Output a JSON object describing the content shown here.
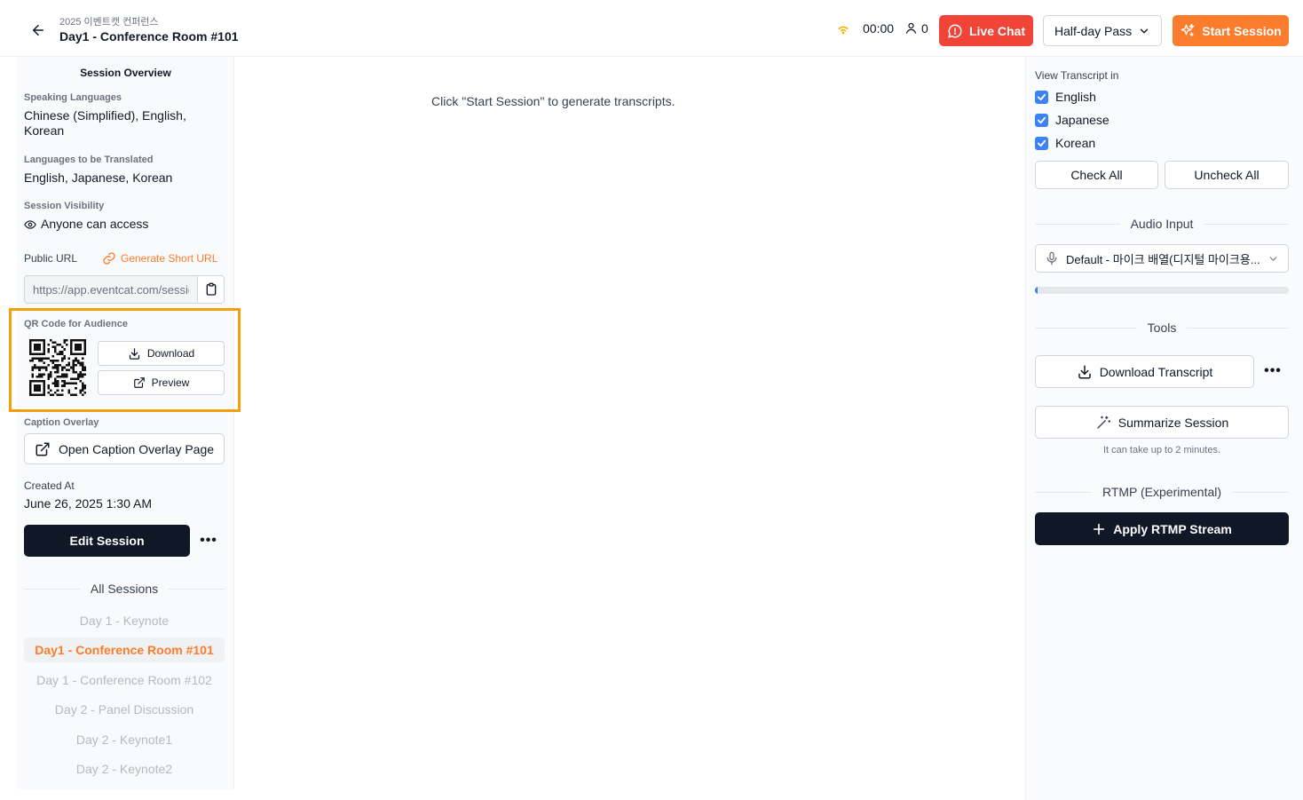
{
  "header": {
    "event_name": "2025 이벤트캣 컨퍼런스",
    "session_title": "Day1 - Conference Room #101",
    "timer": "00:00",
    "audience_count": "0",
    "live_chat_label": "Live Chat",
    "pass_select_value": "Half-day Pass",
    "start_session_label": "Start Session",
    "icons": {
      "back": "arrow-left-icon",
      "signal": "wifi-icon",
      "audience": "user-icon",
      "chat": "chat-bubble-icon",
      "chevron": "chevron-down-icon",
      "sparkle": "sparkle-icon"
    },
    "colors": {
      "live_chat": "#f04438",
      "start_session": "#fb7c2c",
      "signal": "#f5b301"
    }
  },
  "sidebar": {
    "title": "Session Overview",
    "speaking_languages_label": "Speaking Languages",
    "speaking_languages_value": "Chinese (Simplified), English, Korean",
    "translated_languages_label": "Languages to be Translated",
    "translated_languages_value": "English, Japanese, Korean",
    "visibility_label": "Session Visibility",
    "visibility_value": "Anyone can access",
    "public_url_label": "Public URL",
    "generate_short_url_label": "Generate Short URL",
    "public_url_value": "https://app.eventcat.com/session/",
    "qr_label": "QR Code for Audience",
    "qr_download_label": "Download",
    "qr_preview_label": "Preview",
    "caption_overlay_label": "Caption Overlay",
    "open_caption_overlay_label": "Open Caption Overlay Page",
    "created_at_label": "Created At",
    "created_at_value": "June 26, 2025 1:30 AM",
    "edit_session_label": "Edit Session",
    "more_label": "•••",
    "all_sessions_title": "All Sessions",
    "sessions": [
      {
        "label": "Day 1 - Keynote",
        "active": false
      },
      {
        "label": "Day1 - Conference Room #101",
        "active": true
      },
      {
        "label": "Day 1 - Conference Room #102",
        "active": false
      },
      {
        "label": "Day 2 - Panel Discussion",
        "active": false
      },
      {
        "label": "Day 2 - Keynote1",
        "active": false
      },
      {
        "label": "Day 2 - Keynote2",
        "active": false
      }
    ],
    "highlight_color": "#f59e0b"
  },
  "main": {
    "empty_message": "Click \"Start Session\" to generate transcripts."
  },
  "right_panel": {
    "view_transcript_label": "View Transcript in",
    "languages": [
      {
        "label": "English",
        "checked": true
      },
      {
        "label": "Japanese",
        "checked": true
      },
      {
        "label": "Korean",
        "checked": true
      }
    ],
    "check_all_label": "Check All",
    "uncheck_all_label": "Uncheck All",
    "audio_input_title": "Audio Input",
    "audio_input_value": "Default - 마이크 배열(디지털 마이크용...",
    "audio_level": 0.01,
    "tools_title": "Tools",
    "download_transcript_label": "Download Transcript",
    "more_label": "•••",
    "summarize_label": "Summarize Session",
    "summarize_hint": "It can take up to 2 minutes.",
    "rtmp_title": "RTMP (Experimental)",
    "apply_rtmp_label": "Apply RTMP Stream",
    "checkbox_color": "#3b82f6"
  }
}
